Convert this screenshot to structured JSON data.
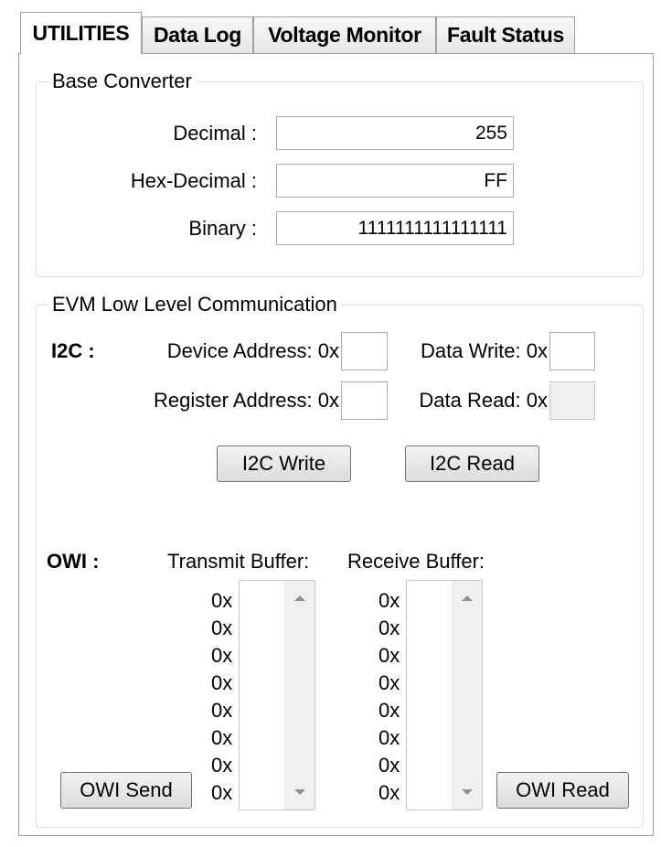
{
  "tabs": [
    {
      "label": "UTILITIES",
      "active": true
    },
    {
      "label": "Data Log",
      "active": false
    },
    {
      "label": "Voltage Monitor",
      "active": false
    },
    {
      "label": "Fault Status",
      "active": false
    }
  ],
  "base_converter": {
    "title": "Base Converter",
    "decimal_label": "Decimal :",
    "decimal_value": "255",
    "hex_label": "Hex-Decimal :",
    "hex_value": "FF",
    "binary_label": "Binary :",
    "binary_value": "1111111111111111"
  },
  "evm": {
    "title": "EVM Low Level Communication",
    "i2c": {
      "label": "I2C :",
      "device_address_label": "Device Address:  0x",
      "device_address_value": "",
      "register_address_label": "Register Address:  0x",
      "register_address_value": "",
      "data_write_label": "Data Write:  0x",
      "data_write_value": "",
      "data_read_label": "Data Read:  0x",
      "data_read_value": "",
      "write_button": "I2C Write",
      "read_button": "I2C Read"
    },
    "owi": {
      "label": "OWI :",
      "transmit_label": "Transmit Buffer:",
      "receive_label": "Receive Buffer:",
      "transmit_prefixes": [
        "0x",
        "0x",
        "0x",
        "0x",
        "0x",
        "0x",
        "0x",
        "0x"
      ],
      "receive_prefixes": [
        "0x",
        "0x",
        "0x",
        "0x",
        "0x",
        "0x",
        "0x",
        "0x"
      ],
      "send_button": "OWI Send",
      "read_button": "OWI Read"
    }
  }
}
